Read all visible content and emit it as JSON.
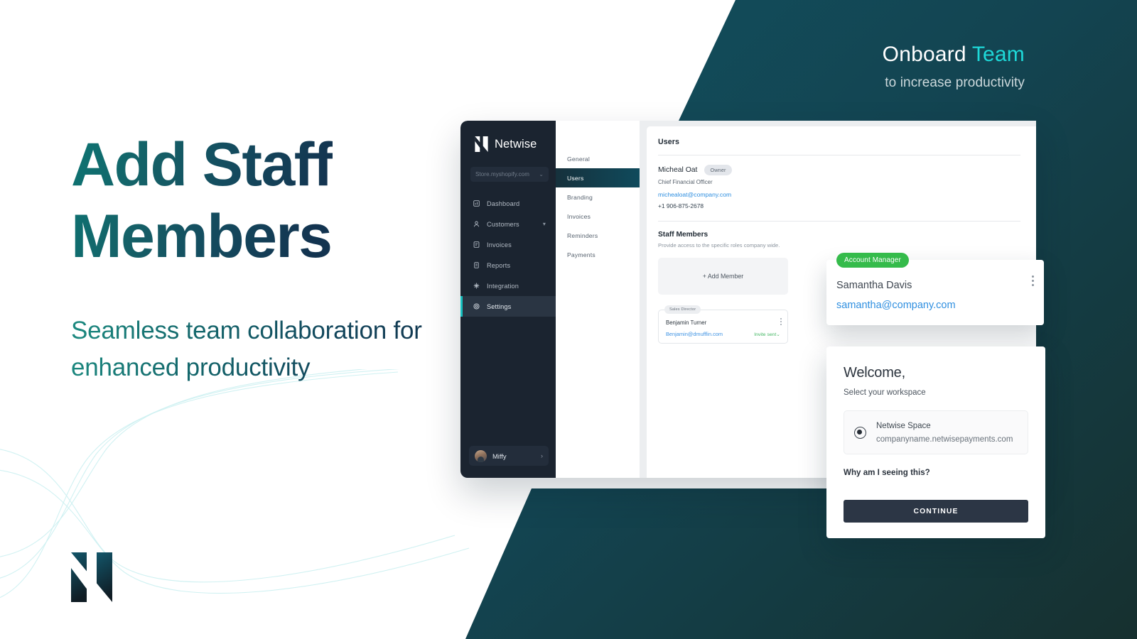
{
  "hero": {
    "headline_line1": "Add Staff",
    "headline_line2": "Members",
    "subheadline": "Seamless team collaboration for enhanced productivity",
    "brand_mark": "netwise-n-logo"
  },
  "kicker": {
    "title_plain": "Onboard ",
    "title_accent": "Team",
    "subtitle": "to increase productivity",
    "accent_color": "#1ed8d8"
  },
  "app": {
    "sidebar": {
      "brand": "Netwise",
      "store_selector": {
        "value": "Store.myshopify.com",
        "chevron": "⌄"
      },
      "items": [
        {
          "label": "Dashboard",
          "icon": "dashboard-icon",
          "active": false,
          "expandable": false
        },
        {
          "label": "Customers",
          "icon": "user-icon",
          "active": false,
          "expandable": true
        },
        {
          "label": "Invoices",
          "icon": "invoice-icon",
          "active": false,
          "expandable": false
        },
        {
          "label": "Reports",
          "icon": "report-icon",
          "active": false,
          "expandable": false
        },
        {
          "label": "Integration",
          "icon": "integration-icon",
          "active": false,
          "expandable": false
        },
        {
          "label": "Settings",
          "icon": "gear-icon",
          "active": true,
          "expandable": false
        }
      ],
      "user": {
        "name": "Miffy",
        "chevron": "›"
      }
    },
    "subnav": {
      "items": [
        {
          "label": "General",
          "active": false
        },
        {
          "label": "Users",
          "active": true
        },
        {
          "label": "Branding",
          "active": false
        },
        {
          "label": "Invoices",
          "active": false
        },
        {
          "label": "Reminders",
          "active": false
        },
        {
          "label": "Payments",
          "active": false
        }
      ]
    },
    "content": {
      "panel_title": "Users",
      "owner": {
        "name": "Micheal Oat",
        "badge": "Owner",
        "role": "Chief Financial Officer",
        "email": "michealoat@company.com",
        "phone": "+1 906-875-2678"
      },
      "staff_section": {
        "title": "Staff Members",
        "subtitle": "Provide access to the specific roles company wide.",
        "add_button": "+ Add Member",
        "members": [
          {
            "tag": "Sales Director",
            "name": "Benjamin Turner",
            "email": "Benjamin@dmufflin.com",
            "status": "Invite sent",
            "status_chevron": "⌄",
            "status_color": "#3db45e"
          }
        ]
      }
    }
  },
  "floating_member_card": {
    "badge": "Account Manager",
    "badge_color": "#35bb4b",
    "name": "Samantha Davis",
    "email": "samantha@company.com",
    "menu_icon": "kebab-menu-icon"
  },
  "welcome_modal": {
    "title": "Welcome,",
    "subtitle": "Select your workspace",
    "workspace": {
      "name": "Netwise Space",
      "url": "companyname.netwisepayments.com",
      "selected": true
    },
    "help_link": "Why am I seeing this?",
    "primary_button": "CONTINUE"
  }
}
